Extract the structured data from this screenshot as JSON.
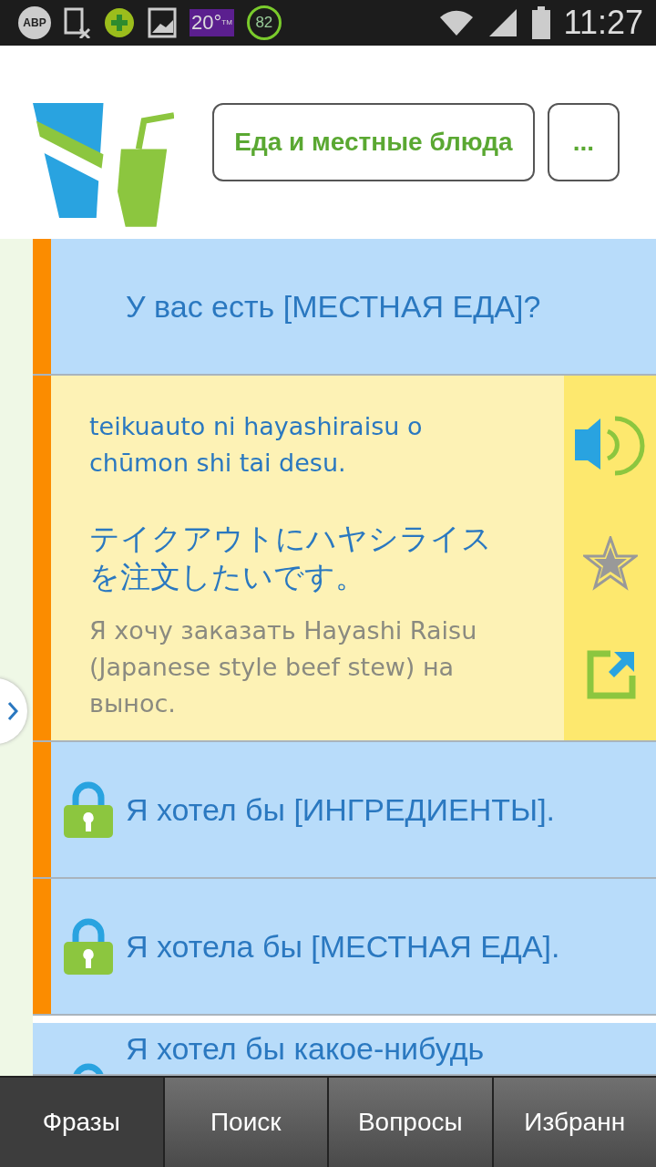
{
  "status_bar": {
    "notifications": [
      {
        "kind": "adblock",
        "label": "ABP"
      },
      {
        "kind": "sim"
      },
      {
        "kind": "plus"
      },
      {
        "kind": "image"
      },
      {
        "kind": "weather",
        "label": "20°",
        "sup": "TM"
      },
      {
        "kind": "ring",
        "label": "82"
      }
    ],
    "time": "11:27"
  },
  "header": {
    "category_button": "Еда и местные блюда",
    "more_button": "..."
  },
  "phrases": [
    {
      "kind": "collapsed",
      "highlighted": true,
      "locked": false,
      "text": "У вас есть [МЕСТНАЯ ЕДА]?"
    },
    {
      "kind": "expanded",
      "highlighted": true,
      "romaji": "teikuauto ni hayashiraisu o chūmon shi tai desu.",
      "japanese": "テイクアウトにハヤシライスを注文したいです。",
      "translation": "Я хочу заказать Hayashi Raisu (Japanese style beef stew) на вынос."
    },
    {
      "kind": "collapsed",
      "highlighted": true,
      "locked": true,
      "text": "Я хотел бы [ИНГРЕДИЕНТЫ]."
    },
    {
      "kind": "collapsed",
      "highlighted": true,
      "locked": true,
      "text": "Я хотела бы [МЕСТНАЯ ЕДА]."
    },
    {
      "kind": "collapsed",
      "highlighted": false,
      "locked": true,
      "text": "Я хотел бы какое-нибудь"
    }
  ],
  "tabs": [
    {
      "label": "Фразы",
      "selected": true
    },
    {
      "label": "Поиск",
      "selected": false
    },
    {
      "label": "Вопросы",
      "selected": false
    },
    {
      "label": "Избранн",
      "selected": false
    }
  ]
}
